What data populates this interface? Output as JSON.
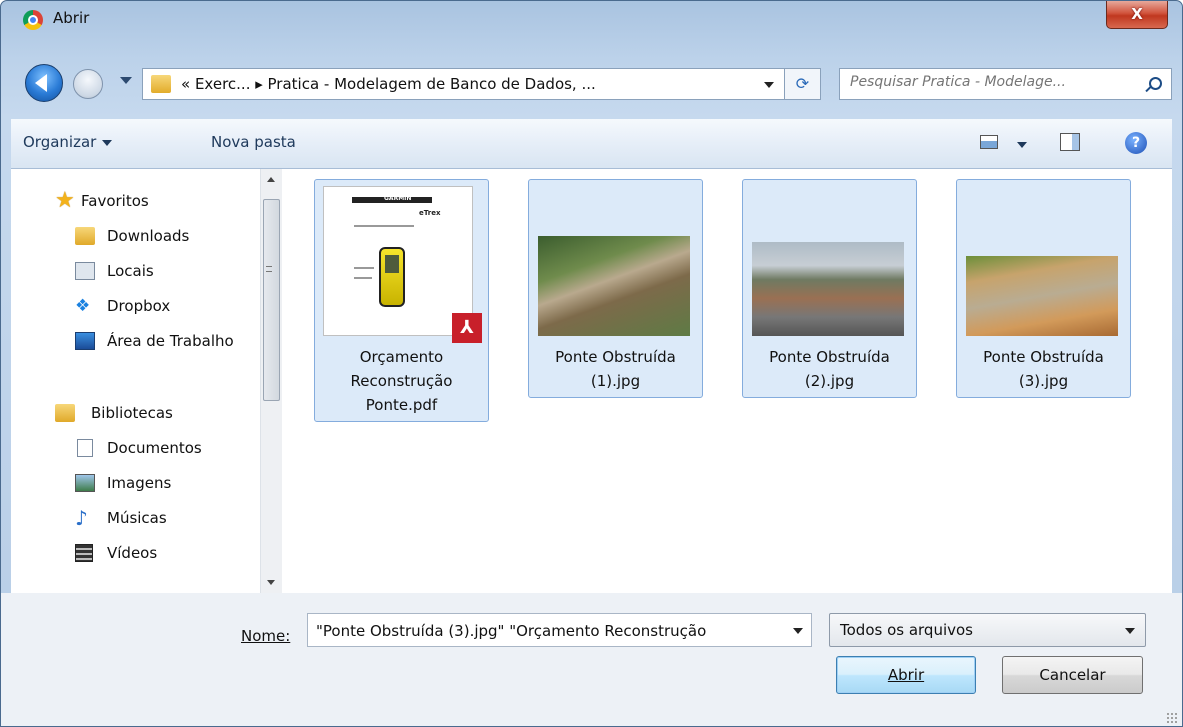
{
  "window": {
    "title": "Abrir",
    "close_label": "X"
  },
  "nav": {
    "address": "« Exerc... ▸ Pratica - Modelagem de Banco de Dados, ...",
    "search_placeholder": "Pesquisar Pratica - Modelage..."
  },
  "toolbar": {
    "organize": "Organizar",
    "new_folder": "Nova pasta"
  },
  "sidebar": {
    "favorites": [
      {
        "label": "Favoritos"
      },
      {
        "label": "Downloads"
      },
      {
        "label": "Locais"
      },
      {
        "label": "Dropbox"
      },
      {
        "label": "Área de Trabalho"
      }
    ],
    "libraries": [
      {
        "label": "Bibliotecas"
      },
      {
        "label": "Documentos"
      },
      {
        "label": "Imagens"
      },
      {
        "label": "Músicas"
      },
      {
        "label": "Vídeos"
      }
    ]
  },
  "files": [
    {
      "line1": "Orçamento",
      "line2": "Reconstrução",
      "line3": "Ponte.pdf",
      "selected": true
    },
    {
      "line1": "Ponte Obstruída",
      "line2": "(1).jpg",
      "selected": true
    },
    {
      "line1": "Ponte Obstruída",
      "line2": "(2).jpg",
      "selected": true
    },
    {
      "line1": "Ponte Obstruída",
      "line2": "(3).jpg",
      "selected": true
    }
  ],
  "pdf_thumb": {
    "brand": "GARMIN",
    "product": "eTrex"
  },
  "footer": {
    "name_label": "Nome:",
    "name_value": "\"Ponte Obstruída (3).jpg\" \"Orçamento Reconstrução",
    "filetype": "Todos os arquivos",
    "open": "Abrir",
    "cancel": "Cancelar"
  }
}
